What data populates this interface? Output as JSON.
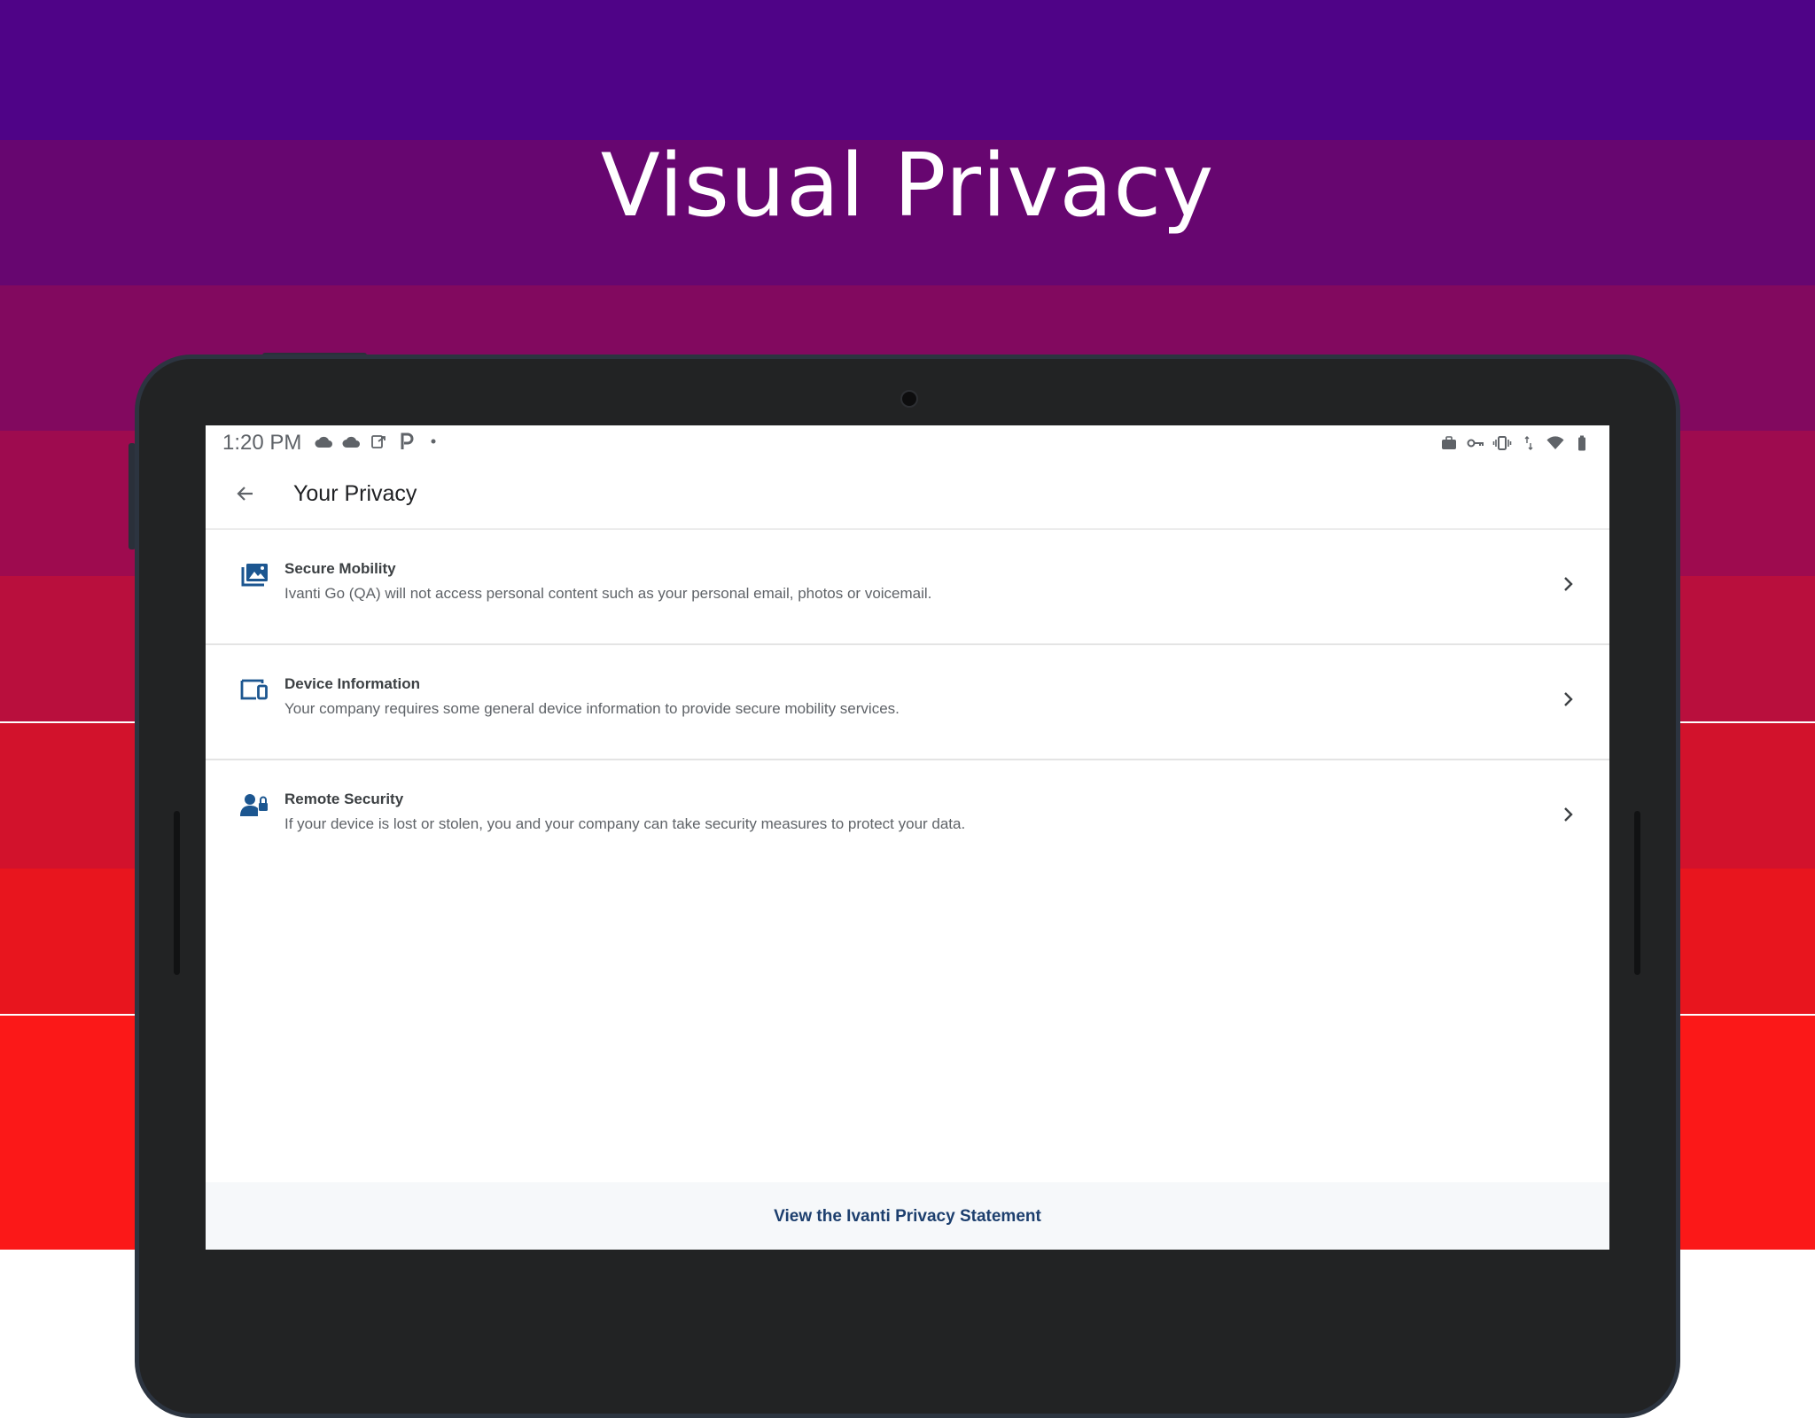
{
  "banner": {
    "headline": "Visual Privacy",
    "colors": [
      "#4f0387",
      "#670670",
      "#82095f",
      "#9e0b4f",
      "#b90f3d",
      "#d2122c",
      "#e8151e",
      "#fb1818"
    ]
  },
  "device": {
    "status_bar": {
      "time": "1:20 PM",
      "left_icons": [
        "weather-cloud-icon",
        "weather-cloud-icon",
        "cast-icon",
        "parking-app-icon",
        "dot-icon"
      ],
      "right_icons": [
        "briefcase-icon",
        "vpn-key-icon",
        "vibrate-icon",
        "data-arrows-icon",
        "wifi-icon",
        "battery-icon"
      ]
    }
  },
  "app": {
    "title": "Your Privacy",
    "accent": "#1c5690",
    "items": [
      {
        "title": "Secure Mobility",
        "description": "Ivanti Go (QA) will not access personal content such as your personal email, photos or voicemail.",
        "icon": "photo-library-icon"
      },
      {
        "title": "Device Information",
        "description": "Your company requires some general device information to provide secure mobility services.",
        "icon": "devices-icon"
      },
      {
        "title": "Remote Security",
        "description": "If your device is lost or stolen, you and your company can take security measures to protect your data.",
        "icon": "user-lock-icon"
      }
    ],
    "footer_link": "View the Ivanti Privacy Statement"
  }
}
